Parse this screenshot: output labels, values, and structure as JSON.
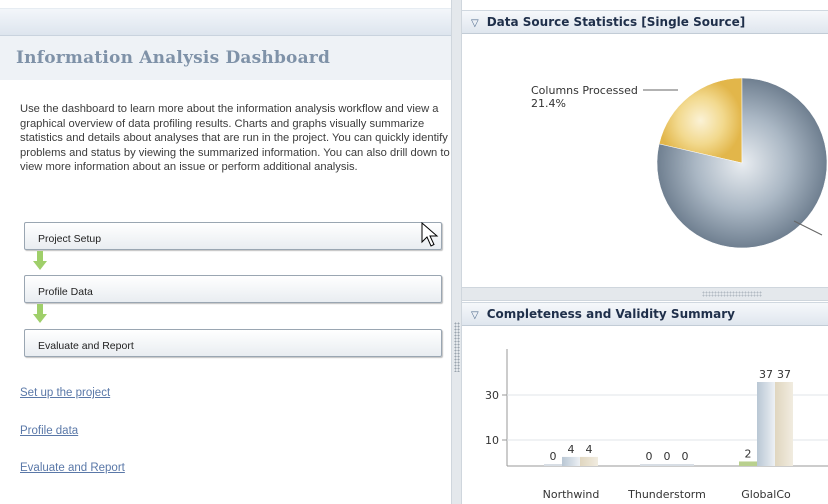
{
  "left_panel": {
    "title": "Information Analysis Dashboard",
    "intro": "Use the dashboard to learn more about the information analysis workflow and view a graphical overview of data profiling results. Charts and graphs visually summarize statistics and details about analyses that are run in the project. You can quickly identify problems and status by viewing the summarized information. You can also drill down to view more information about an issue or perform additional analysis.",
    "steps": [
      "Project Setup",
      "Profile Data",
      "Evaluate and Report"
    ],
    "links": [
      "Set up the project",
      "Profile data",
      "Evaluate and Report"
    ]
  },
  "stats_panel": {
    "title": "Data Source Statistics [Single Source]",
    "collapse_icon": "triangle-down-icon"
  },
  "completeness_panel": {
    "title": "Completeness and Validity Summary",
    "collapse_icon": "triangle-down-icon"
  },
  "colors": {
    "pie_main": "#7b8a9a",
    "pie_highlight": "#e9c35a",
    "arrow_green": "#9fcf6a",
    "link_blue": "#5a78a8"
  },
  "chart_data": [
    {
      "type": "pie",
      "slices": [
        {
          "label": "Columns Processed",
          "value_label": "21.4%",
          "value": 21.4,
          "color": "#e9c35a"
        },
        {
          "label": "",
          "value": 78.6,
          "color": "#7b8a9a"
        }
      ]
    },
    {
      "type": "bar",
      "y_ticks": [
        10,
        30
      ],
      "categories": [
        "Northwind",
        "Thunderstorm",
        "GlobalCo"
      ],
      "series_values": [
        [
          0,
          4,
          4
        ],
        [
          0,
          0,
          0
        ],
        [
          2,
          37,
          37
        ]
      ],
      "value_labels": [
        [
          "0",
          "4",
          "4"
        ],
        [
          "0",
          "0",
          "0"
        ],
        [
          "2",
          "37",
          "37"
        ]
      ],
      "colors": [
        "#b9d08e",
        "#c4d0dc",
        "#e6dcc6"
      ]
    }
  ]
}
